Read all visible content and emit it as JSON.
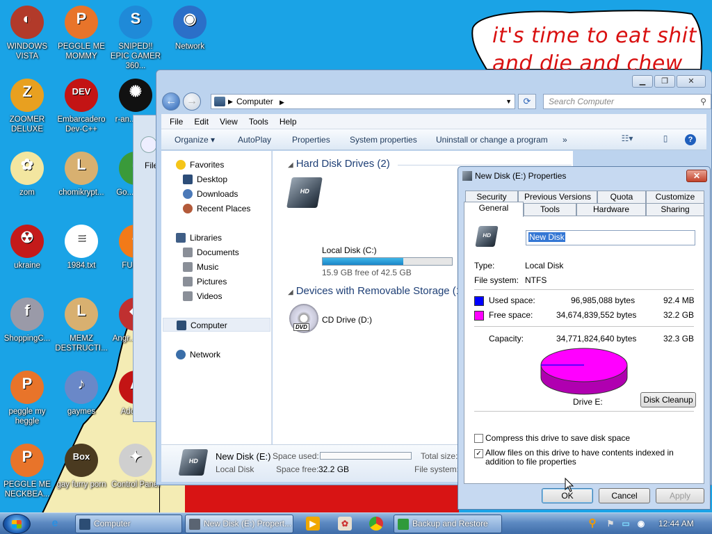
{
  "wallpaper": {
    "speech_line1": "it's time to eat shit",
    "speech_line2": "and die and chew"
  },
  "desktop_icons": [
    {
      "label": "WINDOWS VISTA",
      "icon": "vista-helmet-icon"
    },
    {
      "label": "PEGGLE ME MOMMY",
      "icon": "peggle-icon"
    },
    {
      "label": "SNIPED!! EPIC GAMER 360...",
      "icon": "skype-icon"
    },
    {
      "label": "Network",
      "icon": "network-globe-icon"
    },
    {
      "label": "ZOOMER DELUXE",
      "icon": "zoomer-icon"
    },
    {
      "label": "Embarcadero Dev-C++",
      "icon": "devcpp-icon"
    },
    {
      "label": "r-an... par...",
      "icon": "red-ant-icon"
    },
    {
      "label": "zom",
      "icon": "zombie-flower-icon"
    },
    {
      "label": "chomikrypt...",
      "icon": "hourglass-file-icon"
    },
    {
      "label": "Go... Chr...",
      "icon": "chrome-icon"
    },
    {
      "label": "ukraine",
      "icon": "radiation-icon"
    },
    {
      "label": "1984.txt",
      "icon": "text-file-icon"
    },
    {
      "label": "FURRY",
      "icon": "firefox-icon"
    },
    {
      "label": "ShoppingC...",
      "icon": "flash-icon"
    },
    {
      "label": "MEMZ DESTRUCTI...",
      "icon": "hourglass-file-icon"
    },
    {
      "label": "Angr... Sea...",
      "icon": "angry-birds-icon"
    },
    {
      "label": "peggle my heggle",
      "icon": "peggle-icon"
    },
    {
      "label": "gaymes",
      "icon": "games-folder-icon"
    },
    {
      "label": "Adobe...",
      "icon": "adobe-icon"
    },
    {
      "label": "PEGGLE ME NECKBEA...",
      "icon": "peggle-icon"
    },
    {
      "label": "gay furry porn",
      "icon": "gopher-box-icon"
    },
    {
      "label": "Control Panel",
      "icon": "control-panel-icon"
    }
  ],
  "explorer": {
    "address_crumb": "Computer",
    "search_placeholder": "Search Computer",
    "menu": [
      "File",
      "Edit",
      "View",
      "Tools",
      "Help"
    ],
    "commands": {
      "organize": "Organize",
      "autoplay": "AutoPlay",
      "properties": "Properties",
      "system_properties": "System properties",
      "uninstall": "Uninstall or change a program",
      "more": "»"
    },
    "nav": {
      "favorites": "Favorites",
      "desktop": "Desktop",
      "downloads": "Downloads",
      "recent": "Recent Places",
      "libraries": "Libraries",
      "documents": "Documents",
      "music": "Music",
      "pictures": "Pictures",
      "videos": "Videos",
      "computer": "Computer",
      "network": "Network"
    },
    "groups": {
      "hdd": "Hard Disk Drives (2)",
      "removable": "Devices with Removable Storage (1)"
    },
    "drives": {
      "c_name": "Local Disk (C:)",
      "c_free": "15.9 GB free of 42.5 GB",
      "c_used_fraction": 0.626,
      "c_label": "HD",
      "d_name": "CD Drive (D:)",
      "d_label": "DVD"
    },
    "details": {
      "name": "New Disk (E:)",
      "type": "Local Disk",
      "space_used_label": "Space used:",
      "space_free_label": "Space free:",
      "space_free": "32.2 GB",
      "total_label": "Total size:",
      "fs_label": "File system:"
    }
  },
  "props": {
    "title": "New Disk (E:) Properties",
    "tabs_top": [
      "Security",
      "Previous Versions",
      "Quota",
      "Customize"
    ],
    "tabs_bottom": [
      "General",
      "Tools",
      "Hardware",
      "Sharing"
    ],
    "name_value": "New Disk",
    "type_label": "Type:",
    "type_value": "Local Disk",
    "fs_label": "File system:",
    "fs_value": "NTFS",
    "used_label": "Used space:",
    "used_bytes": "96,985,088 bytes",
    "used_size": "92.4 MB",
    "free_label": "Free space:",
    "free_bytes": "34,674,839,552 bytes",
    "free_size": "32.2 GB",
    "capacity_label": "Capacity:",
    "capacity_bytes": "34,771,824,640 bytes",
    "capacity_size": "32.3 GB",
    "drive_label": "Drive E:",
    "disk_cleanup": "Disk Cleanup",
    "compress_label": "Compress this drive to save disk space",
    "compress_checked": false,
    "index_label": "Allow files on this drive to have contents indexed in addition to file properties",
    "index_checked": true,
    "ok": "OK",
    "cancel": "Cancel",
    "apply": "Apply",
    "used_color": "#0000ff",
    "free_color": "#ff00ff"
  },
  "taskbar": {
    "computer": "Computer",
    "props": "New Disk (E:) Propert...",
    "backup": "Backup and Restore",
    "clock": "12:44 AM"
  }
}
